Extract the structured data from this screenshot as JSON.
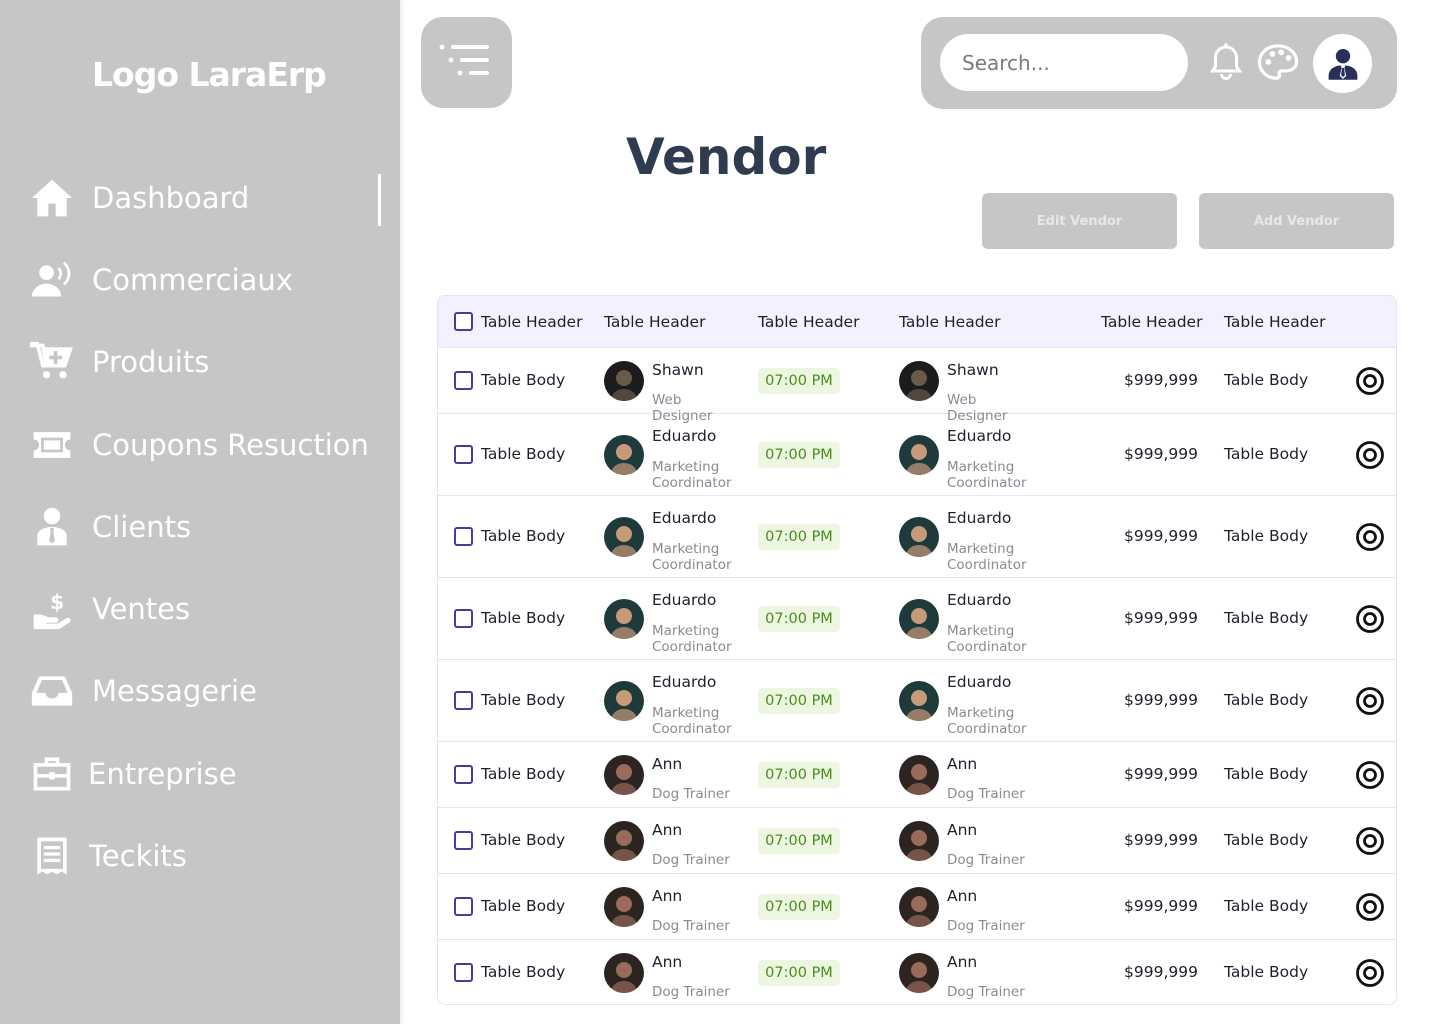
{
  "app": {
    "logo": "Logo LaraErp"
  },
  "sidebar": {
    "items": [
      {
        "label": "Dashboard",
        "icon": "home-icon",
        "active": true
      },
      {
        "label": "Commerciaux",
        "icon": "user-voice-icon"
      },
      {
        "label": "Produits",
        "icon": "cart-plus-icon"
      },
      {
        "label": "Coupons Resuction",
        "icon": "coupon-icon"
      },
      {
        "label": "Clients",
        "icon": "client-icon"
      },
      {
        "label": "Ventes",
        "icon": "hand-dollar-icon"
      },
      {
        "label": "Messagerie",
        "icon": "inbox-icon"
      },
      {
        "label": "Entreprise",
        "icon": "briefcase-icon"
      },
      {
        "label": "Teckits",
        "icon": "receipt-icon"
      }
    ]
  },
  "topbar": {
    "search_placeholder": "Search..."
  },
  "page": {
    "title": "Vendor",
    "edit_label": "Edit Vendor",
    "add_label": "Add Vendor"
  },
  "table": {
    "headers": [
      "Table Header",
      "Table Header",
      "Table Header",
      "Table Header",
      "Table Header",
      "Table Header"
    ],
    "rows": [
      {
        "col1": "Table Body",
        "name": "Shawn",
        "role": "Web Designer",
        "time": "07:00 PM",
        "name2": "Shawn",
        "role2": "Web Designer",
        "amount": "$999,999",
        "col6": "Table Body"
      },
      {
        "col1": "Table Body",
        "name": "Eduardo",
        "role": "Marketing Coordinator",
        "time": "07:00 PM",
        "name2": "Eduardo",
        "role2": "Marketing Coordinator",
        "amount": "$999,999",
        "col6": "Table Body"
      },
      {
        "col1": "Table Body",
        "name": "Eduardo",
        "role": "Marketing Coordinator",
        "time": "07:00 PM",
        "name2": "Eduardo",
        "role2": "Marketing Coordinator",
        "amount": "$999,999",
        "col6": "Table Body"
      },
      {
        "col1": "Table Body",
        "name": "Eduardo",
        "role": "Marketing Coordinator",
        "time": "07:00 PM",
        "name2": "Eduardo",
        "role2": "Marketing Coordinator",
        "amount": "$999,999",
        "col6": "Table Body"
      },
      {
        "col1": "Table Body",
        "name": "Eduardo",
        "role": "Marketing Coordinator",
        "time": "07:00 PM",
        "name2": "Eduardo",
        "role2": "Marketing Coordinator",
        "amount": "$999,999",
        "col6": "Table Body"
      },
      {
        "col1": "Table Body",
        "name": "Ann",
        "role": "Dog Trainer",
        "time": "07:00 PM",
        "name2": "Ann",
        "role2": "Dog Trainer",
        "amount": "$999,999",
        "col6": "Table Body"
      },
      {
        "col1": "Table Body",
        "name": "Ann",
        "role": "Dog Trainer",
        "time": "07:00 PM",
        "name2": "Ann",
        "role2": "Dog Trainer",
        "amount": "$999,999",
        "col6": "Table Body"
      },
      {
        "col1": "Table Body",
        "name": "Ann",
        "role": "Dog Trainer",
        "time": "07:00 PM",
        "name2": "Ann",
        "role2": "Dog Trainer",
        "amount": "$999,999",
        "col6": "Table Body"
      },
      {
        "col1": "Table Body",
        "name": "Ann",
        "role": "Dog Trainer",
        "time": "07:00 PM",
        "name2": "Ann",
        "role2": "Dog Trainer",
        "amount": "$999,999",
        "col6": "Table Body"
      }
    ]
  },
  "colors": {
    "sidebar_bg": "#c6c6c6",
    "header_bg": "#f3f0ff",
    "checkbox_border": "#4a3aa0",
    "badge_bg": "#ecf6e0",
    "badge_text": "#4b8c1d",
    "title": "#2f3b4f"
  }
}
